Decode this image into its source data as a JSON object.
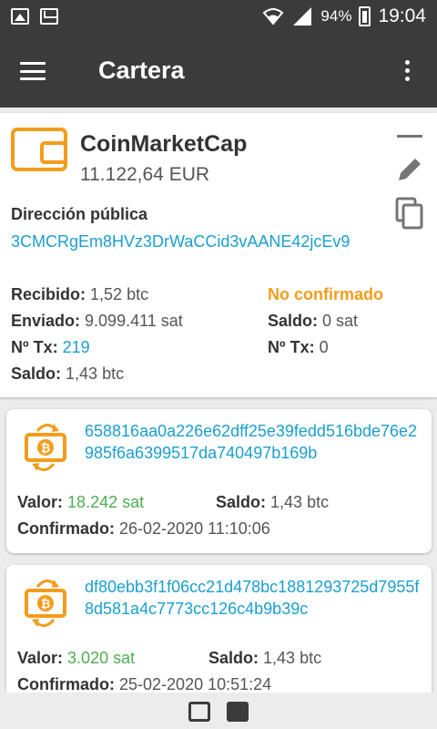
{
  "status": {
    "battery": "94%",
    "time": "19:04"
  },
  "appbar": {
    "title": "Cartera"
  },
  "wallet": {
    "name": "CoinMarketCap",
    "balance": "11.122,64 EUR",
    "address_label": "Dirección pública",
    "address": "3CMCRgEm8HVz3DrWaCCid3vAANE42jcEv9",
    "received_label": "Recibido:",
    "received": "1,52 btc",
    "sent_label": "Enviado:",
    "sent": "9.099.411 sat",
    "ntx_label": "Nº Tx:",
    "ntx": "219",
    "saldo_label": "Saldo:",
    "saldo": "1,43 btc",
    "unconfirmed_title": "No confirmado",
    "unc_saldo_label": "Saldo:",
    "unc_saldo": "0 sat",
    "unc_ntx_label": "Nº Tx:",
    "unc_ntx": "0"
  },
  "transactions": [
    {
      "hash": "658816aa0a226e62dff25e39fedd516bde76e2985f6a6399517da740497b169b",
      "valor_label": "Valor:",
      "valor": "18.242 sat",
      "saldo_label": "Saldo:",
      "saldo": "1,43 btc",
      "confirmado_label": "Confirmado:",
      "confirmado": "26-02-2020 11:10:06"
    },
    {
      "hash": "df80ebb3f1f06cc21d478bc1881293725d7955f8d581a4c7773cc126c4b9b39c",
      "valor_label": "Valor:",
      "valor": "3.020 sat",
      "saldo_label": "Saldo:",
      "saldo": "1,43 btc",
      "confirmado_label": "Confirmado:",
      "confirmado": "25-02-2020 10:51:24"
    }
  ],
  "colors": {
    "accent": "#f39c1c",
    "link": "#1a9fd0",
    "positive": "#4caf50",
    "bar": "#3b3b3b"
  }
}
